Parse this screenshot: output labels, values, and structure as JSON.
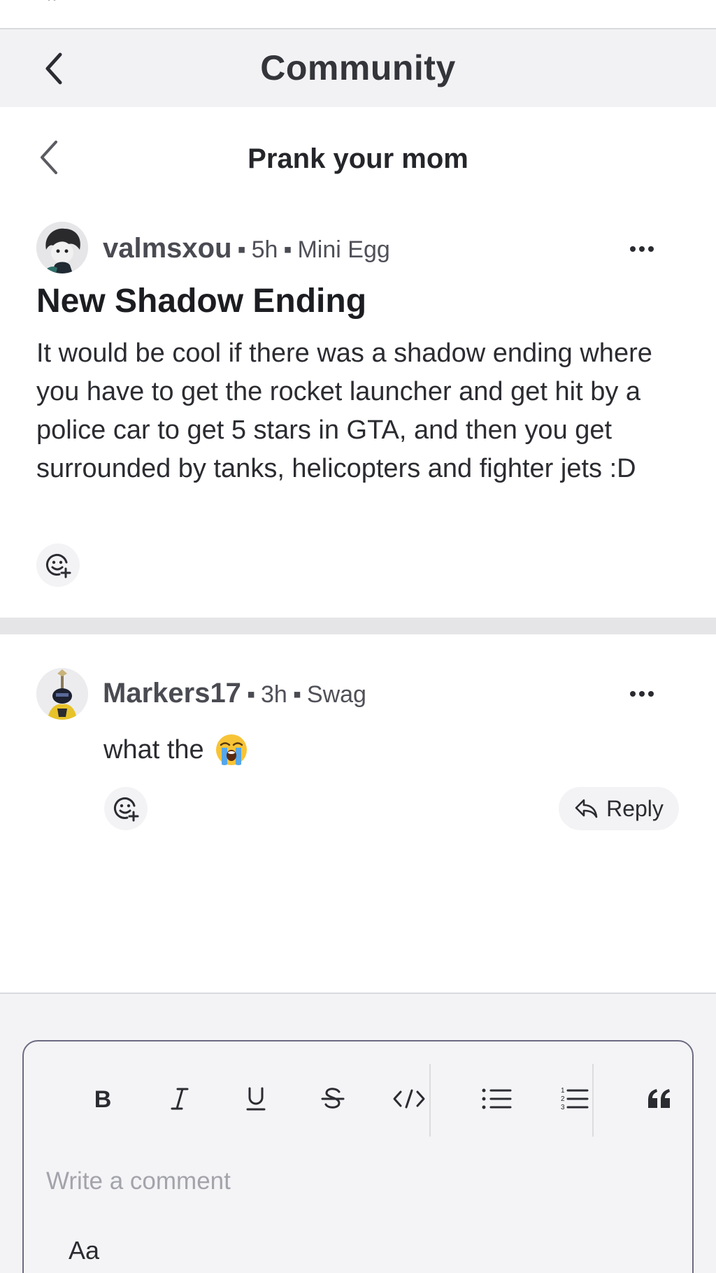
{
  "nav": {
    "title": "Community",
    "back_icon": "chevron-left-icon"
  },
  "subheader": {
    "title": "Prank your mom",
    "back_icon": "chevron-left-icon"
  },
  "post": {
    "author": "valmsxou",
    "time": "5h",
    "flair": "Mini Egg",
    "headline": "New Shadow Ending",
    "body": "It would be cool if there was a shadow ending where you have to get the rocket launcher and get hit by a police car to get 5 stars in GTA, and then you get surrounded by tanks, helicopters and fighter jets :D",
    "more_icon": "more-horizontal-icon",
    "react_icon": "add-reaction-icon"
  },
  "comment": {
    "author": "Markers17",
    "time": "3h",
    "flair": "Swag",
    "text": "what the",
    "emoji": "loudly-crying-face-emoji",
    "reply_label": "Reply",
    "reply_icon": "reply-arrow-icon",
    "more_icon": "more-horizontal-icon",
    "react_icon": "add-reaction-icon"
  },
  "composer": {
    "placeholder": "Write a comment",
    "format_toggle": "Aa",
    "toolbar": [
      "bold",
      "italic",
      "underline",
      "strikethrough",
      "code",
      "bulleted-list",
      "numbered-list",
      "quote"
    ],
    "colors": {
      "border": "#6b6a82",
      "background": "#f4f4f6"
    }
  },
  "colors": {
    "nav_bg": "#f2f2f4",
    "divider": "#e5e5e8",
    "text": "#1f2024",
    "muted": "#4f5058"
  }
}
